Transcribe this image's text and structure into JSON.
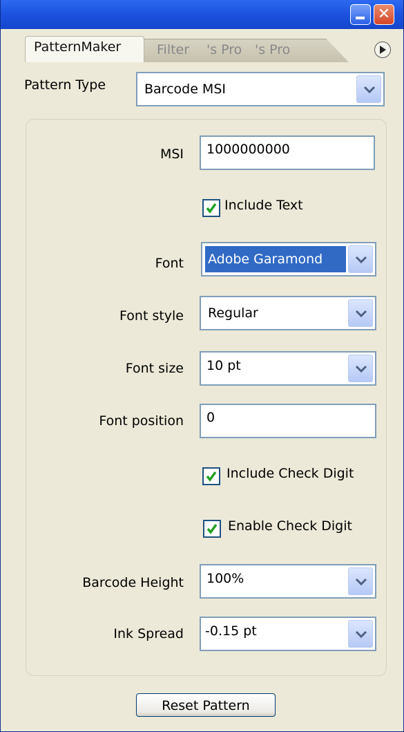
{
  "window": {
    "minimize_label": "minimize",
    "close_label": "close"
  },
  "tabs": [
    {
      "label": "PatternMaker"
    },
    {
      "label": "Filter"
    },
    {
      "label": "'s Pro"
    },
    {
      "label": "'s Pro"
    }
  ],
  "pattern_type": {
    "label": "Pattern Type",
    "value": "Barcode MSI"
  },
  "fields": {
    "msi": {
      "label": "MSI",
      "value": "1000000000"
    },
    "include_text": {
      "label": "Include Text",
      "checked": true
    },
    "font": {
      "label": "Font",
      "value": "Adobe Garamond"
    },
    "font_style": {
      "label": "Font style",
      "value": "Regular"
    },
    "font_size": {
      "label": "Font size",
      "value": "10 pt"
    },
    "font_position": {
      "label": "Font position",
      "value": "0"
    },
    "include_check_digit": {
      "label": "Include Check Digit",
      "checked": true
    },
    "enable_check_digit": {
      "label": "Enable Check Digit",
      "checked": true
    },
    "barcode_height": {
      "label": "Barcode Height",
      "value": "100%"
    },
    "ink_spread": {
      "label": "Ink Spread",
      "value": "-0.15 pt"
    }
  },
  "reset_button": "Reset Pattern",
  "icons": {
    "minimize": "minimize-icon",
    "close": "close-icon",
    "panel_menu": "panel-menu-icon",
    "dropdown": "chevron-down-icon",
    "checkbox": "checkmark-icon"
  },
  "colors": {
    "title_bar": "#1d53e0",
    "panel_bg": "#ece9d8",
    "selection": "#316ac5",
    "check_green": "#21a121"
  }
}
